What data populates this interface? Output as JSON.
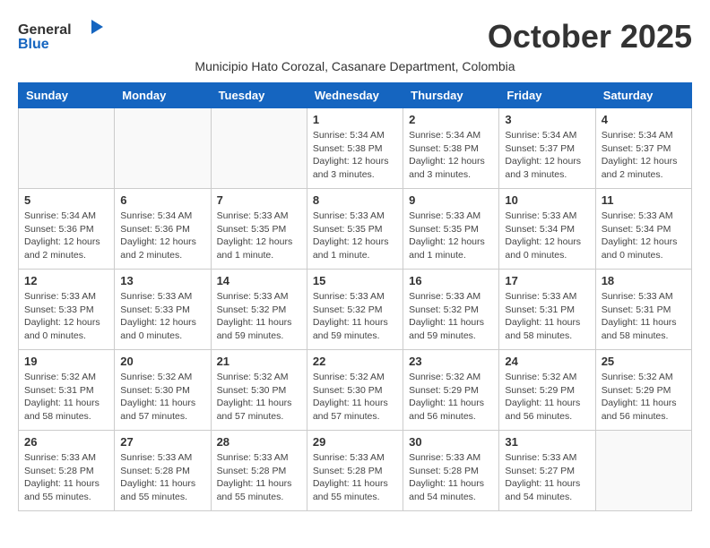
{
  "header": {
    "logo_general": "General",
    "logo_blue": "Blue",
    "month_title": "October 2025",
    "subtitle": "Municipio Hato Corozal, Casanare Department, Colombia"
  },
  "days_of_week": [
    "Sunday",
    "Monday",
    "Tuesday",
    "Wednesday",
    "Thursday",
    "Friday",
    "Saturday"
  ],
  "weeks": [
    [
      {
        "day": "",
        "info": ""
      },
      {
        "day": "",
        "info": ""
      },
      {
        "day": "",
        "info": ""
      },
      {
        "day": "1",
        "info": "Sunrise: 5:34 AM\nSunset: 5:38 PM\nDaylight: 12 hours\nand 3 minutes."
      },
      {
        "day": "2",
        "info": "Sunrise: 5:34 AM\nSunset: 5:38 PM\nDaylight: 12 hours\nand 3 minutes."
      },
      {
        "day": "3",
        "info": "Sunrise: 5:34 AM\nSunset: 5:37 PM\nDaylight: 12 hours\nand 3 minutes."
      },
      {
        "day": "4",
        "info": "Sunrise: 5:34 AM\nSunset: 5:37 PM\nDaylight: 12 hours\nand 2 minutes."
      }
    ],
    [
      {
        "day": "5",
        "info": "Sunrise: 5:34 AM\nSunset: 5:36 PM\nDaylight: 12 hours\nand 2 minutes."
      },
      {
        "day": "6",
        "info": "Sunrise: 5:34 AM\nSunset: 5:36 PM\nDaylight: 12 hours\nand 2 minutes."
      },
      {
        "day": "7",
        "info": "Sunrise: 5:33 AM\nSunset: 5:35 PM\nDaylight: 12 hours\nand 1 minute."
      },
      {
        "day": "8",
        "info": "Sunrise: 5:33 AM\nSunset: 5:35 PM\nDaylight: 12 hours\nand 1 minute."
      },
      {
        "day": "9",
        "info": "Sunrise: 5:33 AM\nSunset: 5:35 PM\nDaylight: 12 hours\nand 1 minute."
      },
      {
        "day": "10",
        "info": "Sunrise: 5:33 AM\nSunset: 5:34 PM\nDaylight: 12 hours\nand 0 minutes."
      },
      {
        "day": "11",
        "info": "Sunrise: 5:33 AM\nSunset: 5:34 PM\nDaylight: 12 hours\nand 0 minutes."
      }
    ],
    [
      {
        "day": "12",
        "info": "Sunrise: 5:33 AM\nSunset: 5:33 PM\nDaylight: 12 hours\nand 0 minutes."
      },
      {
        "day": "13",
        "info": "Sunrise: 5:33 AM\nSunset: 5:33 PM\nDaylight: 12 hours\nand 0 minutes."
      },
      {
        "day": "14",
        "info": "Sunrise: 5:33 AM\nSunset: 5:32 PM\nDaylight: 11 hours\nand 59 minutes."
      },
      {
        "day": "15",
        "info": "Sunrise: 5:33 AM\nSunset: 5:32 PM\nDaylight: 11 hours\nand 59 minutes."
      },
      {
        "day": "16",
        "info": "Sunrise: 5:33 AM\nSunset: 5:32 PM\nDaylight: 11 hours\nand 59 minutes."
      },
      {
        "day": "17",
        "info": "Sunrise: 5:33 AM\nSunset: 5:31 PM\nDaylight: 11 hours\nand 58 minutes."
      },
      {
        "day": "18",
        "info": "Sunrise: 5:33 AM\nSunset: 5:31 PM\nDaylight: 11 hours\nand 58 minutes."
      }
    ],
    [
      {
        "day": "19",
        "info": "Sunrise: 5:32 AM\nSunset: 5:31 PM\nDaylight: 11 hours\nand 58 minutes."
      },
      {
        "day": "20",
        "info": "Sunrise: 5:32 AM\nSunset: 5:30 PM\nDaylight: 11 hours\nand 57 minutes."
      },
      {
        "day": "21",
        "info": "Sunrise: 5:32 AM\nSunset: 5:30 PM\nDaylight: 11 hours\nand 57 minutes."
      },
      {
        "day": "22",
        "info": "Sunrise: 5:32 AM\nSunset: 5:30 PM\nDaylight: 11 hours\nand 57 minutes."
      },
      {
        "day": "23",
        "info": "Sunrise: 5:32 AM\nSunset: 5:29 PM\nDaylight: 11 hours\nand 56 minutes."
      },
      {
        "day": "24",
        "info": "Sunrise: 5:32 AM\nSunset: 5:29 PM\nDaylight: 11 hours\nand 56 minutes."
      },
      {
        "day": "25",
        "info": "Sunrise: 5:32 AM\nSunset: 5:29 PM\nDaylight: 11 hours\nand 56 minutes."
      }
    ],
    [
      {
        "day": "26",
        "info": "Sunrise: 5:33 AM\nSunset: 5:28 PM\nDaylight: 11 hours\nand 55 minutes."
      },
      {
        "day": "27",
        "info": "Sunrise: 5:33 AM\nSunset: 5:28 PM\nDaylight: 11 hours\nand 55 minutes."
      },
      {
        "day": "28",
        "info": "Sunrise: 5:33 AM\nSunset: 5:28 PM\nDaylight: 11 hours\nand 55 minutes."
      },
      {
        "day": "29",
        "info": "Sunrise: 5:33 AM\nSunset: 5:28 PM\nDaylight: 11 hours\nand 55 minutes."
      },
      {
        "day": "30",
        "info": "Sunrise: 5:33 AM\nSunset: 5:28 PM\nDaylight: 11 hours\nand 54 minutes."
      },
      {
        "day": "31",
        "info": "Sunrise: 5:33 AM\nSunset: 5:27 PM\nDaylight: 11 hours\nand 54 minutes."
      },
      {
        "day": "",
        "info": ""
      }
    ]
  ]
}
